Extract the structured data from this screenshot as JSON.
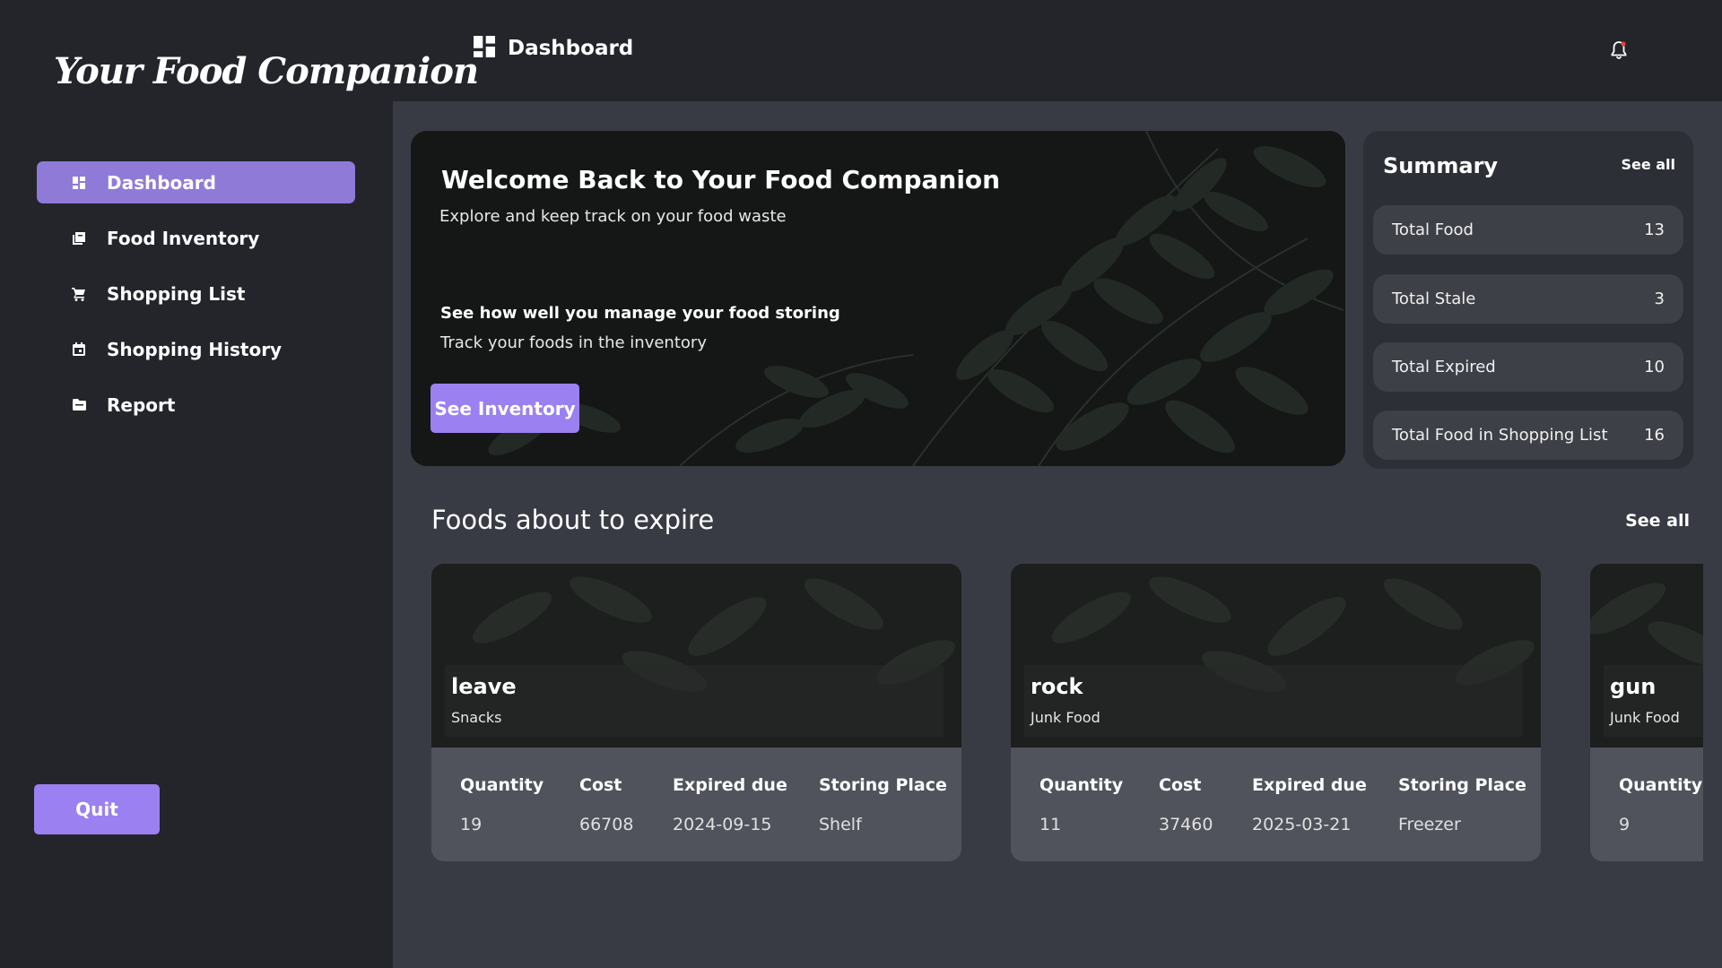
{
  "app": {
    "logo": "Your Food Companion"
  },
  "sidebar": {
    "items": [
      {
        "label": "Dashboard",
        "icon": "dashboard-icon",
        "active": true
      },
      {
        "label": "Food Inventory",
        "icon": "inventory-icon",
        "active": false
      },
      {
        "label": "Shopping List",
        "icon": "cart-icon",
        "active": false
      },
      {
        "label": "Shopping History",
        "icon": "calendar-icon",
        "active": false
      },
      {
        "label": "Report",
        "icon": "folder-icon",
        "active": false
      }
    ],
    "quit_label": "Quit"
  },
  "header": {
    "title": "Dashboard",
    "icon": "dashboard-icon",
    "notification_icon": "bell-icon"
  },
  "hero": {
    "title": "Welcome Back to Your Food Companion",
    "subtitle": "Explore and keep track on your food waste",
    "heading2": "See how well you manage your food storing",
    "subtitle2": "Track your foods in the inventory",
    "button_label": "See Inventory"
  },
  "summary": {
    "title": "Summary",
    "see_all": "See all",
    "rows": [
      {
        "label": "Total Food",
        "value": "13"
      },
      {
        "label": "Total Stale",
        "value": "3"
      },
      {
        "label": "Total Expired",
        "value": "10"
      },
      {
        "label": "Total Food in Shopping List",
        "value": "16"
      }
    ]
  },
  "expiring": {
    "title": "Foods about to expire",
    "see_all": "See all",
    "columns": [
      "Quantity",
      "Cost",
      "Expired due",
      "Storing Place"
    ],
    "cards": [
      {
        "name": "leave",
        "category": "Snacks",
        "quantity": "19",
        "cost": "66708",
        "expired_due": "2024-09-15",
        "storing_place": "Shelf"
      },
      {
        "name": "rock",
        "category": "Junk Food",
        "quantity": "11",
        "cost": "37460",
        "expired_due": "2025-03-21",
        "storing_place": "Freezer"
      },
      {
        "name": "gun",
        "category": "Junk Food",
        "quantity": "9",
        "cost": "",
        "expired_due": "",
        "storing_place": ""
      }
    ]
  },
  "colors": {
    "accent": "#9b80f2",
    "active_nav": "#8f7ad8",
    "sidebar_bg": "#23252b",
    "main_bg": "#393b44"
  }
}
